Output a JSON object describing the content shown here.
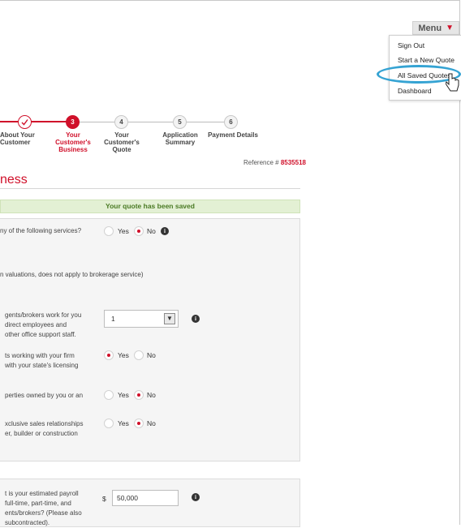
{
  "menu": {
    "label": "Menu",
    "items": [
      "Sign Out",
      "Start a New Quote",
      "All Saved Quotes",
      "Dashboard"
    ]
  },
  "steps": [
    {
      "number": "✓",
      "label": "About Your\nCustomer",
      "state": "done"
    },
    {
      "number": "3",
      "label": "Your\nCustomer's\nBusiness",
      "state": "active"
    },
    {
      "number": "4",
      "label": "Your\nCustomer's\nQuote",
      "state": "future"
    },
    {
      "number": "5",
      "label": "Application\nSummary",
      "state": "future"
    },
    {
      "number": "6",
      "label": "Payment Details",
      "state": "future"
    }
  ],
  "reference": {
    "label": "Reference #",
    "number": "8535518"
  },
  "section_title": "ness",
  "saved_message": "Your quote has been saved",
  "questions": {
    "services": {
      "text": "ny of the following services?",
      "yes": "Yes",
      "no": "No",
      "selected": "No"
    },
    "valuations_note": "n valuations, does not apply to brokerage service)",
    "agents_count": {
      "lines": [
        "gents/brokers work for you",
        "direct   employees   and",
        "other office support staff."
      ],
      "value": "1"
    },
    "licensed": {
      "lines": [
        "ts working with your firm",
        "with your state's licensing"
      ],
      "yes": "Yes",
      "no": "No",
      "selected": "Yes"
    },
    "properties": {
      "text": "perties owned by you or an",
      "yes": "Yes",
      "no": "No",
      "selected": "No"
    },
    "exclusive": {
      "lines": [
        "xclusive sales relationships",
        "er,  builder  or  construction"
      ],
      "yes": "Yes",
      "no": "No",
      "selected": "No"
    },
    "payroll": {
      "lines": [
        "t  is  your  estimated  payroll",
        "full-time,   part-time,   and",
        "ents/brokers? (Please also",
        "subcontracted)."
      ],
      "currency": "$",
      "value": "50,000"
    }
  },
  "colors": {
    "accent": "#d0102a",
    "success_bg": "#e3f0d4",
    "success_text": "#4a7a24",
    "highlight": "#35a3d3"
  },
  "icons": {
    "info": "info-icon",
    "menu_arrow": "triangle-down-icon",
    "cursor": "hand-pointer-icon"
  }
}
